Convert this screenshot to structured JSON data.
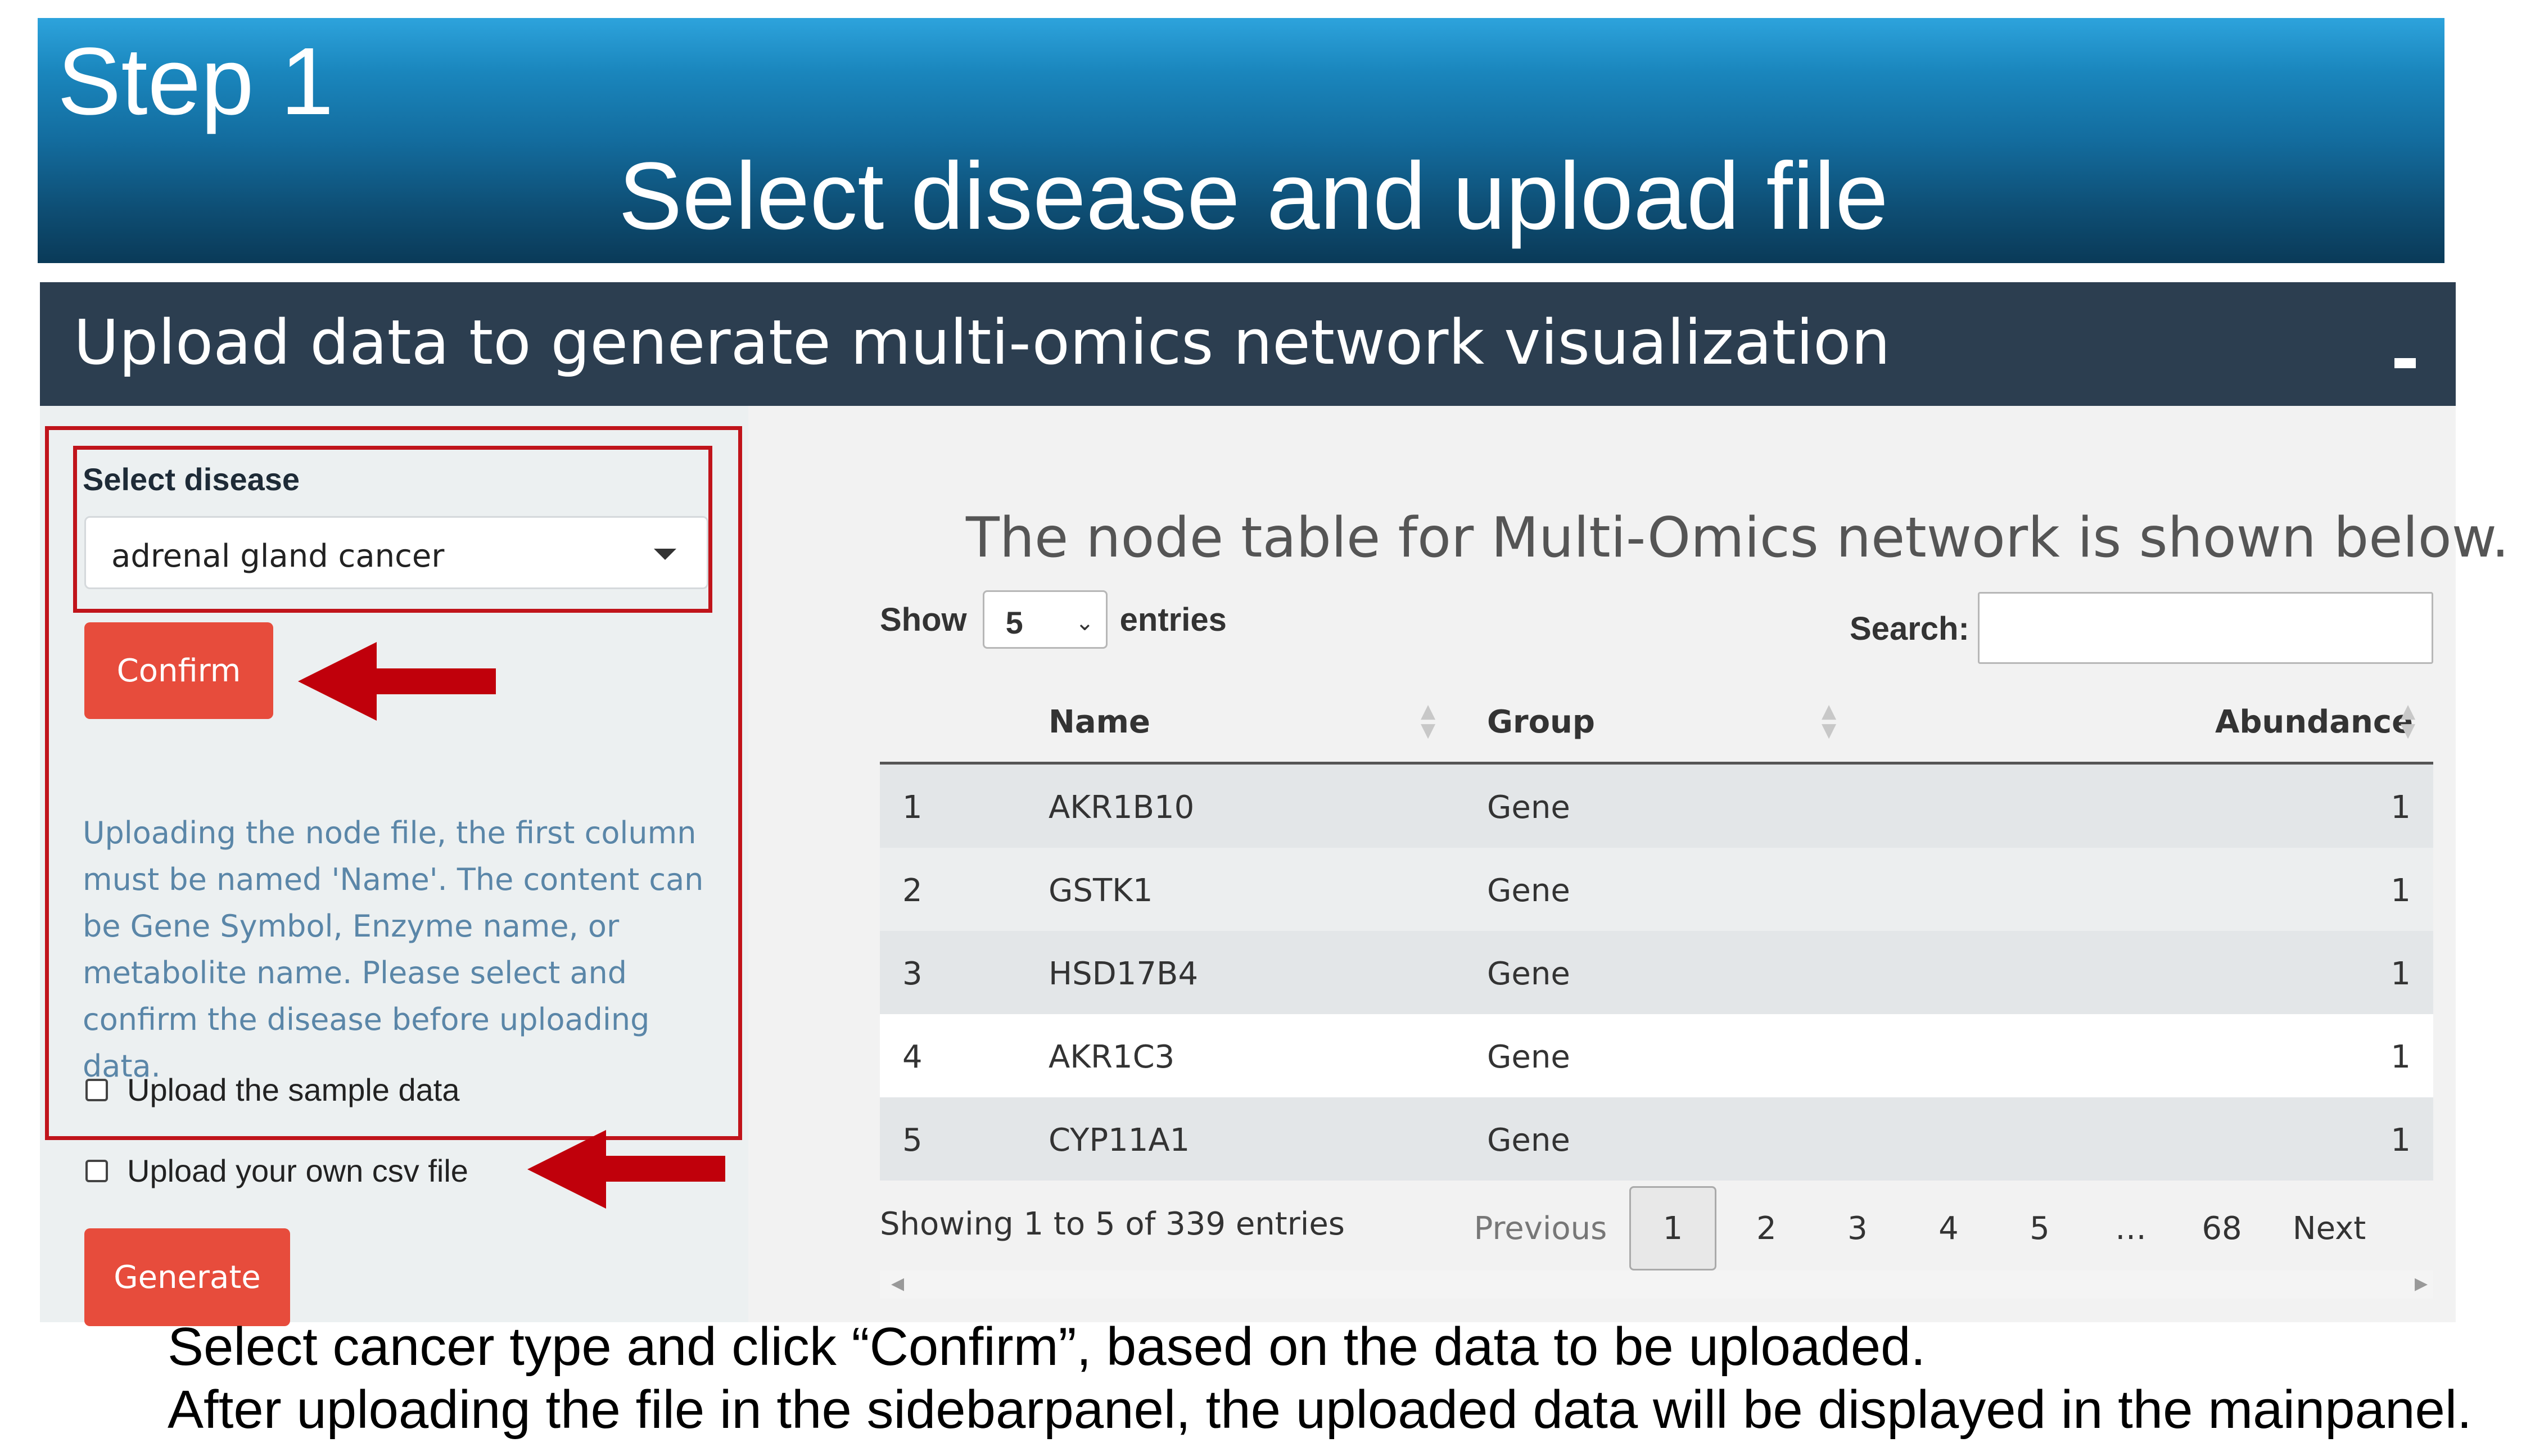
{
  "banner": {
    "step": "Step 1",
    "subtitle": "Select disease and upload file"
  },
  "app": {
    "title": "Upload data to generate multi-omics network visualization",
    "collapse_icon": "minus-icon"
  },
  "sidebar": {
    "select_label": "Select disease",
    "selected_disease": "adrenal gland cancer",
    "confirm_label": "Confirm",
    "help_text": "Uploading the node file, the first column must be named 'Name'. The content can be Gene Symbol, Enzyme name, or metabolite name. Please select and confirm the disease before uploading data.",
    "sample_checkbox": "Upload the sample data",
    "csv_checkbox": "Upload your own csv file",
    "generate_label": "Generate"
  },
  "main": {
    "heading": "The node table for Multi-Omics network is shown below.",
    "show_label": "Show",
    "entries_value": "5",
    "entries_label": "entries",
    "search_label": "Search:",
    "columns": [
      "Name",
      "Group",
      "Abundance"
    ],
    "rows": [
      {
        "idx": "1",
        "name": "AKR1B10",
        "group": "Gene",
        "abundance": "1"
      },
      {
        "idx": "2",
        "name": "GSTK1",
        "group": "Gene",
        "abundance": "1"
      },
      {
        "idx": "3",
        "name": "HSD17B4",
        "group": "Gene",
        "abundance": "1"
      },
      {
        "idx": "4",
        "name": "AKR1C3",
        "group": "Gene",
        "abundance": "1"
      },
      {
        "idx": "5",
        "name": "CYP11A1",
        "group": "Gene",
        "abundance": "1"
      }
    ],
    "info": "Showing 1 to 5 of 339 entries",
    "pagination": {
      "previous": "Previous",
      "pages": [
        "1",
        "2",
        "3",
        "4",
        "5",
        "…",
        "68"
      ],
      "next": "Next"
    }
  },
  "caption": {
    "line1": "Select cancer type and click “Confirm”, based on the data to be uploaded.",
    "line2": "After uploading the file in the sidebarpanel, the uploaded data will be displayed in the mainpanel."
  },
  "colors": {
    "header_bg": "#2c3e50",
    "button_red": "#e74c3c",
    "annotation_red": "#c0141b",
    "help_text": "#5a86a8"
  }
}
